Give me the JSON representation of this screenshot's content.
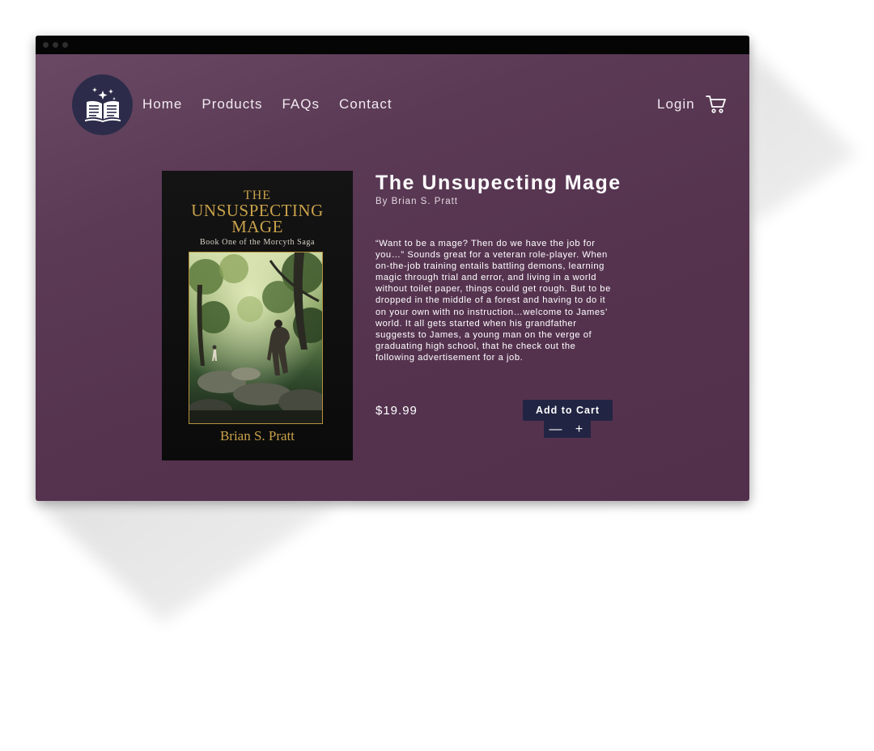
{
  "nav": {
    "items": [
      {
        "label": "Home"
      },
      {
        "label": "Products"
      },
      {
        "label": "FAQs"
      },
      {
        "label": "Contact"
      }
    ],
    "login_label": "Login",
    "cart_icon": "cart-icon",
    "logo_icon": "open-book-sparkles-icon"
  },
  "product": {
    "title": "The Unsupecting Mage",
    "author_line": "By Brian S. Pratt",
    "description": "“Want to be a mage? Then do we have the job for you…” Sounds great for a veteran role-player. When on-the-job training entails battling demons, learning magic through trial and error, and living in a world without toilet paper, things could get rough. But to be dropped in the middle of a forest and having to do it on your own with no instruction…welcome to James’ world. It all gets started when his grandfather suggests to James, a young man on the verge of graduating high school, that he check out the following advertisement for a job.",
    "price": "$19.99",
    "add_to_cart_label": "Add to Cart",
    "qty_minus": "—",
    "qty_plus": "+"
  },
  "cover": {
    "title_line1": "THE",
    "title_line2": "UNSUSPECTING",
    "title_line3": "MAGE",
    "subtitle": "Book One of the Morcyth Saga",
    "author": "Brian S. Pratt"
  },
  "colors": {
    "background": "#5a3855",
    "button": "#222443",
    "cover_gold": "#c9a24a",
    "titlebar": "#050505"
  }
}
